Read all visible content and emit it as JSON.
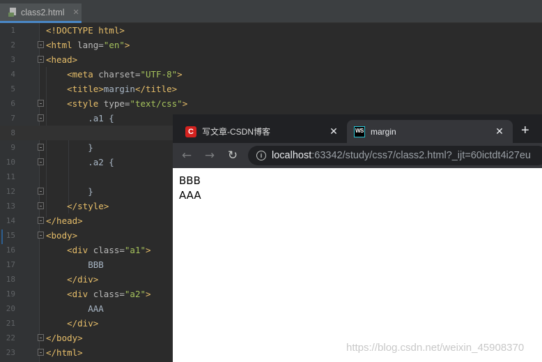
{
  "ide": {
    "tab": {
      "label": "class2.html",
      "close": "✕"
    },
    "lines": [
      {
        "n": "1",
        "parts": [
          [
            "t",
            "<!DOCTYPE html>"
          ]
        ]
      },
      {
        "n": "2",
        "parts": [
          [
            "t",
            "<html "
          ],
          [
            "a",
            "lang="
          ],
          [
            "v",
            "\"en\""
          ],
          [
            "t",
            ">"
          ]
        ]
      },
      {
        "n": "3",
        "parts": [
          [
            "t",
            "<head>"
          ]
        ]
      },
      {
        "n": "4",
        "parts": [
          [
            "s",
            "    "
          ],
          [
            "t",
            "<meta "
          ],
          [
            "a",
            "charset="
          ],
          [
            "v",
            "\"UTF-8\""
          ],
          [
            "t",
            ">"
          ]
        ]
      },
      {
        "n": "5",
        "parts": [
          [
            "s",
            "    "
          ],
          [
            "t",
            "<title>"
          ],
          [
            "txt",
            "margin"
          ],
          [
            "t",
            "</title>"
          ]
        ]
      },
      {
        "n": "6",
        "parts": [
          [
            "s",
            "    "
          ],
          [
            "t",
            "<style "
          ],
          [
            "a",
            "type="
          ],
          [
            "v",
            "\"text/css\""
          ],
          [
            "t",
            ">"
          ]
        ]
      },
      {
        "n": "7",
        "parts": [
          [
            "s",
            "        .a1 {"
          ]
        ]
      },
      {
        "n": "8",
        "parts": [
          [
            "s",
            ""
          ]
        ]
      },
      {
        "n": "9",
        "parts": [
          [
            "s",
            "        }"
          ]
        ]
      },
      {
        "n": "10",
        "parts": [
          [
            "s",
            "        .a2 {"
          ]
        ]
      },
      {
        "n": "11",
        "parts": [
          [
            "s",
            ""
          ]
        ]
      },
      {
        "n": "12",
        "parts": [
          [
            "s",
            "        }"
          ]
        ]
      },
      {
        "n": "13",
        "parts": [
          [
            "s",
            "    "
          ],
          [
            "t",
            "</style>"
          ]
        ]
      },
      {
        "n": "14",
        "parts": [
          [
            "t",
            "</head>"
          ]
        ]
      },
      {
        "n": "15",
        "parts": [
          [
            "t",
            "<body>"
          ]
        ]
      },
      {
        "n": "16",
        "parts": [
          [
            "s",
            "    "
          ],
          [
            "t",
            "<div "
          ],
          [
            "a",
            "class="
          ],
          [
            "v",
            "\"a1\""
          ],
          [
            "t",
            ">"
          ]
        ]
      },
      {
        "n": "17",
        "parts": [
          [
            "txt",
            "        BBB"
          ]
        ]
      },
      {
        "n": "18",
        "parts": [
          [
            "s",
            "    "
          ],
          [
            "t",
            "</div>"
          ]
        ]
      },
      {
        "n": "19",
        "parts": [
          [
            "s",
            "    "
          ],
          [
            "t",
            "<div "
          ],
          [
            "a",
            "class="
          ],
          [
            "v",
            "\"a2\""
          ],
          [
            "t",
            ">"
          ]
        ]
      },
      {
        "n": "20",
        "parts": [
          [
            "txt",
            "        AAA"
          ]
        ]
      },
      {
        "n": "21",
        "parts": [
          [
            "s",
            "    "
          ],
          [
            "t",
            "</div>"
          ]
        ]
      },
      {
        "n": "22",
        "parts": [
          [
            "t",
            "</body>"
          ]
        ]
      },
      {
        "n": "23",
        "parts": [
          [
            "t",
            "</html>"
          ]
        ]
      }
    ],
    "current_line": "8",
    "fold_lines": [
      "2",
      "3",
      "6",
      "7",
      "9",
      "10",
      "12",
      "13",
      "14",
      "15",
      "22",
      "23"
    ]
  },
  "browser": {
    "tabs": [
      {
        "title": "写文章-CSDN博客",
        "favicon": "C",
        "close": "✕"
      },
      {
        "title": "margin",
        "favicon": "WS",
        "close": "✕"
      }
    ],
    "new_tab": "+",
    "nav": {
      "back": "←",
      "forward": "→",
      "reload": "↻"
    },
    "info_icon": "i",
    "url_host": "localhost",
    "url_rest": ":63342/study/css7/class2.html?_ijt=60ictdt4i27eu",
    "page": {
      "line1": "BBB",
      "line2": "AAA"
    }
  },
  "watermark": "https://blog.csdn.net/weixin_45908370",
  "colors": {
    "ide_bg": "#2b2b2b",
    "gutter": "#313335",
    "tag": "#e8bf6a",
    "attr": "#bababa",
    "value": "#a5c25c",
    "text": "#a9b7c6",
    "browser_frame": "#202124",
    "browser_toolbar": "#35363a",
    "csdn_red": "#d4221f"
  }
}
